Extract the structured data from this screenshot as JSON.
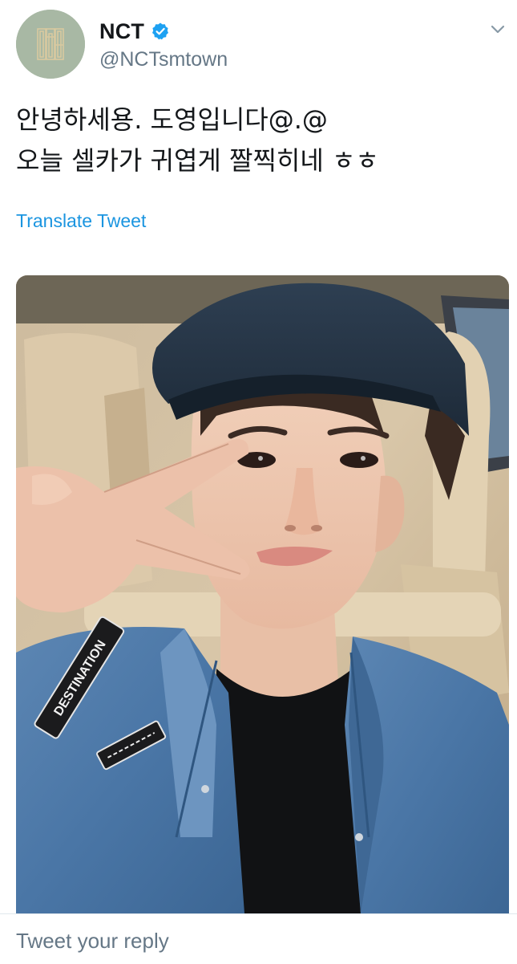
{
  "tweet": {
    "author": {
      "display_name": "NCT",
      "handle": "@NCTsmtown",
      "verified": true,
      "avatar_icon": "nct-logo-icon",
      "avatar_color": "#a8b8a4"
    },
    "text_lines": [
      "안녕하세용. 도영입니다@.@",
      "오늘 셀카가 귀엽게 짤찍히네 ㅎㅎ"
    ],
    "translate_label": "Translate Tweet",
    "media": {
      "type": "photo",
      "patch_text": "DESTINATION"
    }
  },
  "reply": {
    "placeholder": "Tweet your reply"
  },
  "colors": {
    "link": "#1b95e0",
    "secondary_text": "#657786",
    "verified_badge": "#1da1f2",
    "border": "#e1e8ed"
  }
}
